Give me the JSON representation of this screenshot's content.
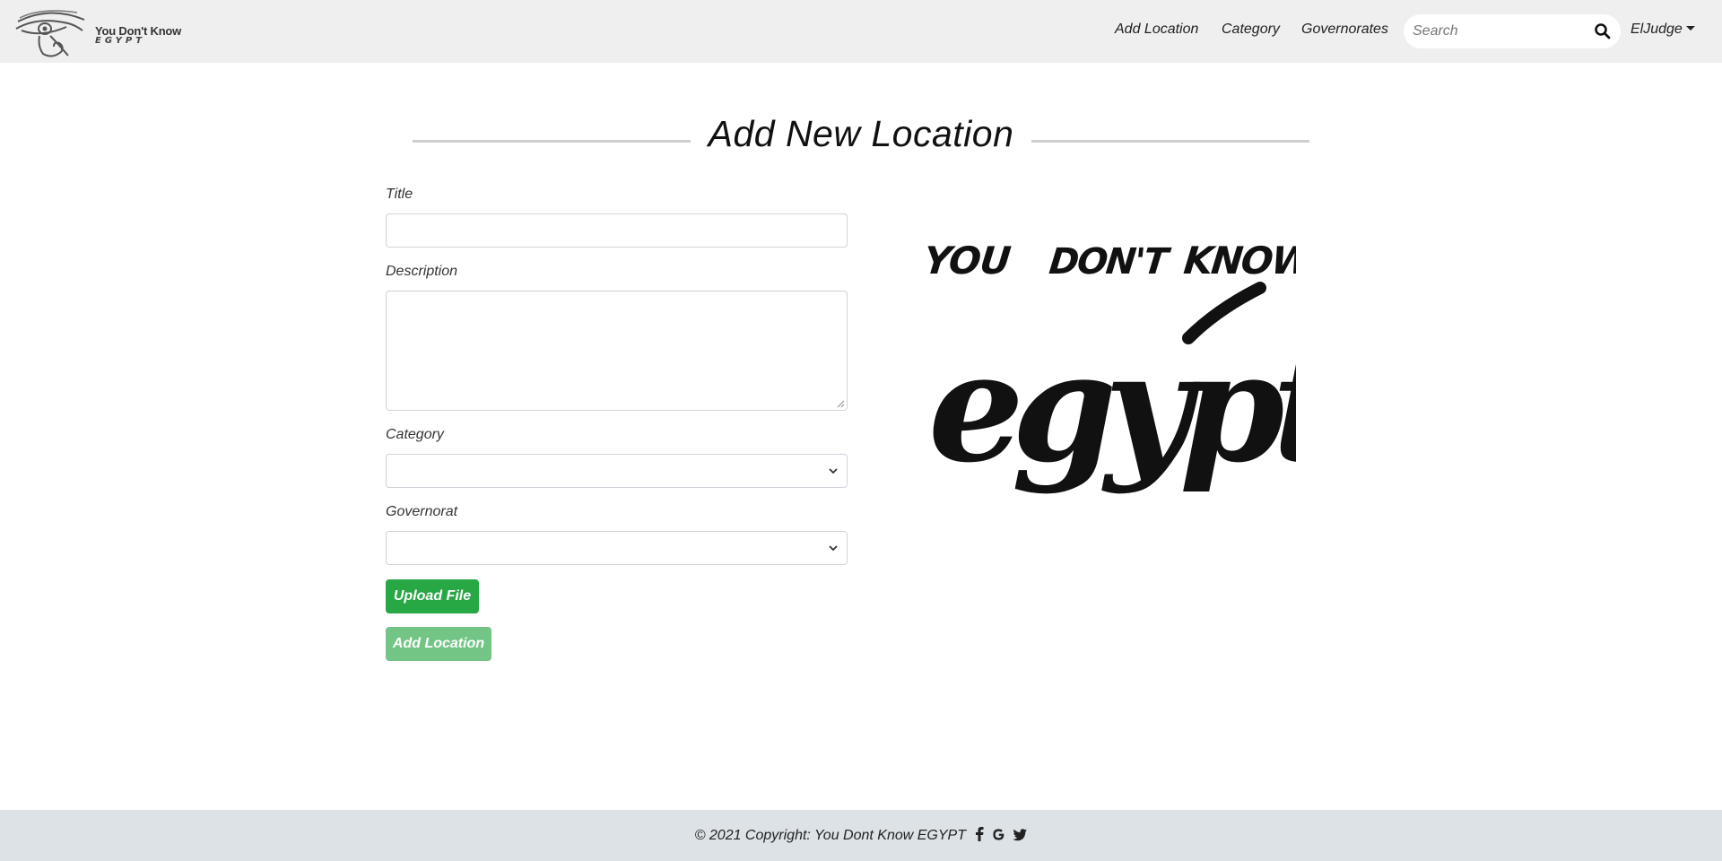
{
  "brand": {
    "line1": "You Don't Know",
    "line2": "EGYPT"
  },
  "nav": {
    "add_location": "Add Location",
    "category": "Category",
    "governorates": "Governorates",
    "search_placeholder": "Search",
    "user": "ElJudge"
  },
  "page": {
    "title": "Add New Location"
  },
  "form": {
    "title_label": "Title",
    "title_value": "",
    "description_label": "Description",
    "description_value": "",
    "category_label": "Category",
    "category_selected": "",
    "governorate_label": "Governorat",
    "governorate_selected": "",
    "upload_button": "Upload File",
    "submit_button": "Add Location"
  },
  "art": {
    "words": [
      "YOU",
      "DON'T",
      "KNOW"
    ],
    "script_word": "egypt"
  },
  "footer": {
    "copyright": "© 2021 Copyright: You Dont Know EGYPT",
    "social_icons": [
      "facebook-icon",
      "google-icon",
      "twitter-icon"
    ]
  },
  "colors": {
    "navbar_bg": "#efefef",
    "footer_bg": "#dde2e6",
    "button_green": "#28a745"
  }
}
